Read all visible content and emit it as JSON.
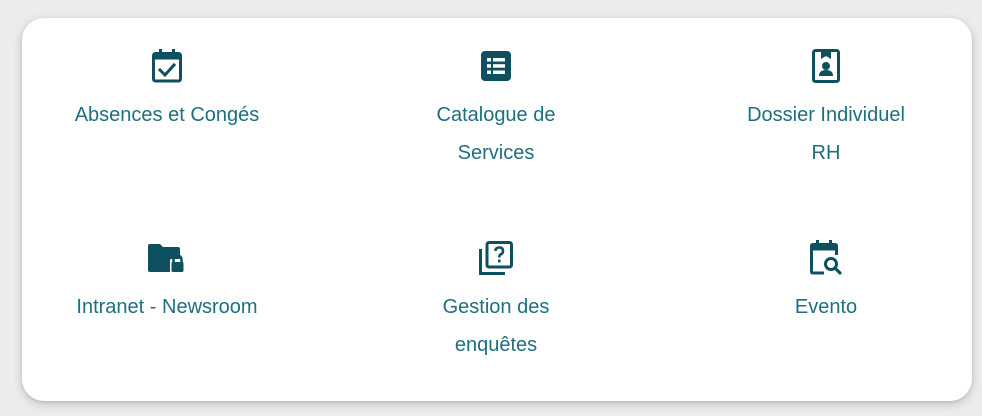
{
  "theme": {
    "icon_color": "#0e4f60",
    "label_color": "#1e6f80",
    "card_background": "#ffffff",
    "page_background": "#ececec"
  },
  "apps": [
    {
      "label": "Absences et Congés",
      "icon": "calendar-check-icon"
    },
    {
      "label": "Catalogue de Services",
      "icon": "list-icon"
    },
    {
      "label": "Dossier Individuel RH",
      "icon": "contact-card-icon"
    },
    {
      "label": "Intranet - Newsroom",
      "icon": "folder-lock-icon"
    },
    {
      "label": "Gestion des enquêtes",
      "icon": "question-stack-icon"
    },
    {
      "label": "Evento",
      "icon": "calendar-search-icon"
    }
  ]
}
